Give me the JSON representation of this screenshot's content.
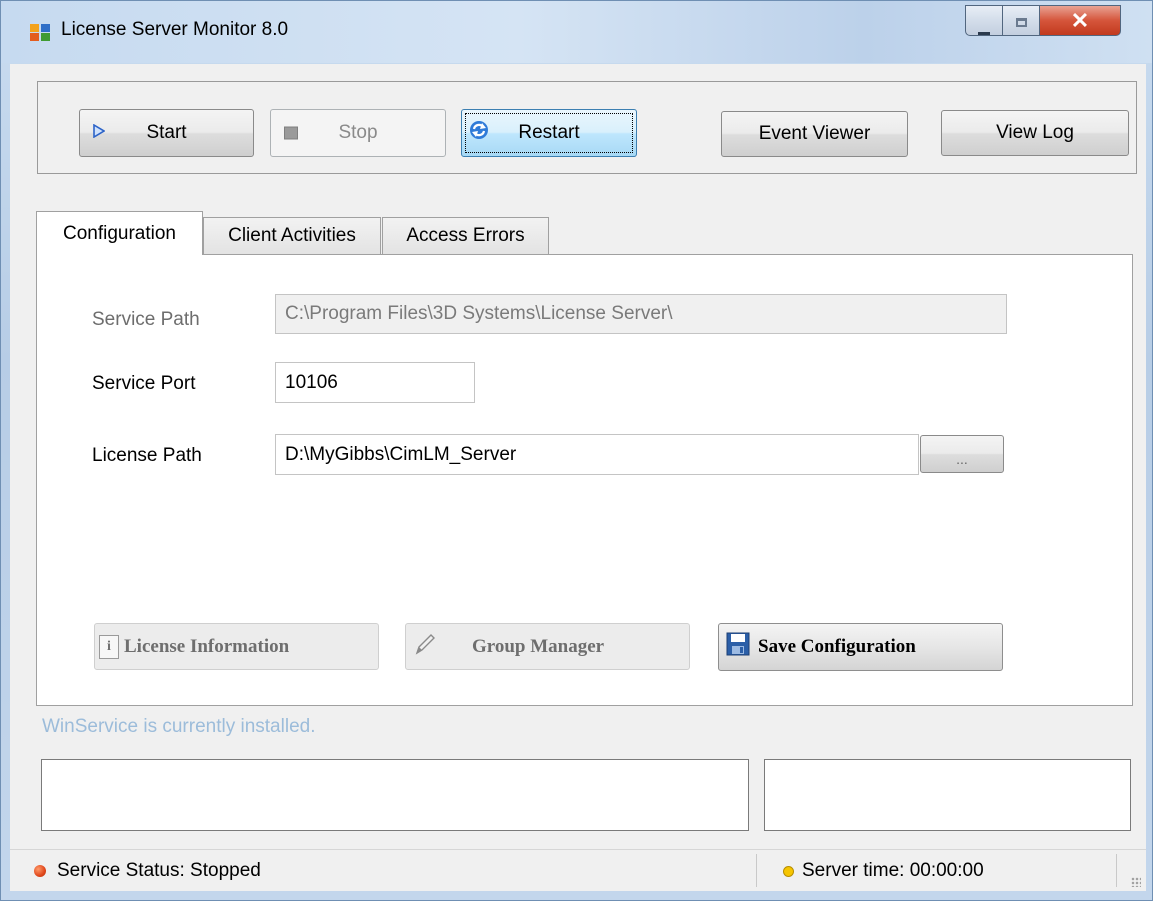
{
  "window": {
    "title": "License Server Monitor 8.0",
    "controls": {
      "minimize": "–",
      "maximize": "□",
      "close": "✕"
    }
  },
  "toolbar": {
    "start_label": "Start",
    "stop_label": "Stop",
    "restart_label": "Restart",
    "event_viewer_label": "Event Viewer",
    "view_log_label": "View Log"
  },
  "tabs": {
    "configuration": "Configuration",
    "client_activities": "Client Activities",
    "access_errors": "Access Errors"
  },
  "config": {
    "service_path_label": "Service Path",
    "service_path_value": "C:\\Program Files\\3D Systems\\License Server\\",
    "service_port_label": "Service Port",
    "service_port_value": "10106",
    "license_path_label": "License Path",
    "license_path_value": "D:\\MyGibbs\\CimLM_Server",
    "browse_label": "...",
    "license_info_label": "License Information",
    "group_manager_label": "Group Manager",
    "save_config_label": "Save Configuration"
  },
  "install_status": "WinService is currently installed.",
  "statusbar": {
    "service_status": "Service Status: Stopped",
    "server_time": "Server time: 00:00:00"
  },
  "colors": {
    "status_stopped": "#e0471b",
    "clock": "#e8b300",
    "install_status_text": "#9cbcda"
  }
}
